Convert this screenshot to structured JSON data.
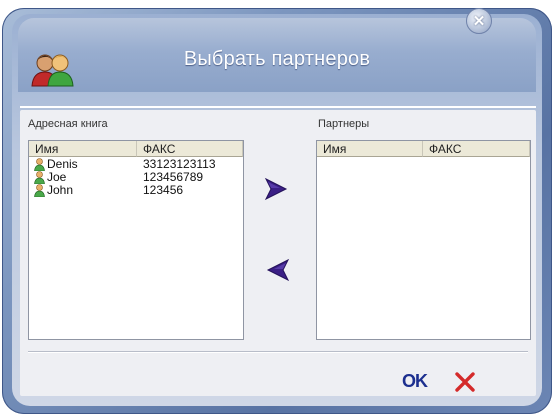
{
  "dialog": {
    "title": "Выбрать партнеров"
  },
  "address_book": {
    "label": "Адресная книга",
    "columns": [
      "Имя",
      "ФАКС"
    ],
    "rows": [
      {
        "name": "Denis",
        "fax": "33123123113"
      },
      {
        "name": "Joe",
        "fax": "123456789"
      },
      {
        "name": "John",
        "fax": "123456"
      }
    ]
  },
  "partners": {
    "label": "Партнеры",
    "columns": [
      "Имя",
      "ФАКС"
    ],
    "rows": []
  },
  "buttons": {
    "ok": "OK"
  },
  "icons": {
    "close": "close-icon",
    "avatar": "users-icon",
    "contact": "contact-icon",
    "add": "arrow-right-icon",
    "remove": "arrow-left-icon",
    "cancel": "cancel-x-icon"
  },
  "colors": {
    "arrow": "#3a1f85",
    "cancel": "#d42a2a",
    "ok": "#1c2f8f"
  }
}
